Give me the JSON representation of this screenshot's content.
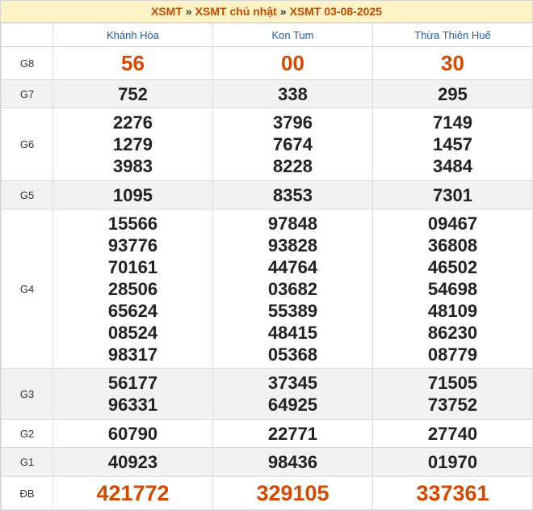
{
  "breadcrumb": {
    "items": [
      "XSMT",
      "XSMT chủ nhật",
      "XSMT 03-08-2025"
    ],
    "separator": "»"
  },
  "provinces": [
    "Khánh Hòa",
    "Kon Tum",
    "Thừa Thiên Huế"
  ],
  "colors": {
    "accent": "#d04a02",
    "link": "#1d5ea8",
    "header_bg": "#fdf3c6",
    "row_alt": "#f2f2f2"
  },
  "prizes": {
    "g8": {
      "label": "G8",
      "values": [
        [
          "56"
        ],
        [
          "00"
        ],
        [
          "30"
        ]
      ]
    },
    "g7": {
      "label": "G7",
      "values": [
        [
          "752"
        ],
        [
          "338"
        ],
        [
          "295"
        ]
      ]
    },
    "g6": {
      "label": "G6",
      "values": [
        [
          "2276",
          "1279",
          "3983"
        ],
        [
          "3796",
          "7674",
          "8228"
        ],
        [
          "7149",
          "1457",
          "3484"
        ]
      ]
    },
    "g5": {
      "label": "G5",
      "values": [
        [
          "1095"
        ],
        [
          "8353"
        ],
        [
          "7301"
        ]
      ]
    },
    "g4": {
      "label": "G4",
      "values": [
        [
          "15566",
          "93776",
          "70161",
          "28506",
          "65624",
          "08524",
          "98317"
        ],
        [
          "97848",
          "93828",
          "44764",
          "03682",
          "55389",
          "48415",
          "05368"
        ],
        [
          "09467",
          "36808",
          "46502",
          "54698",
          "48109",
          "86230",
          "08779"
        ]
      ]
    },
    "g3": {
      "label": "G3",
      "values": [
        [
          "56177",
          "96331"
        ],
        [
          "37345",
          "64925"
        ],
        [
          "71505",
          "73752"
        ]
      ]
    },
    "g2": {
      "label": "G2",
      "values": [
        [
          "60790"
        ],
        [
          "22771"
        ],
        [
          "27740"
        ]
      ]
    },
    "g1": {
      "label": "G1",
      "values": [
        [
          "40923"
        ],
        [
          "98436"
        ],
        [
          "01970"
        ]
      ]
    },
    "db": {
      "label": "ĐB",
      "values": [
        [
          "421772"
        ],
        [
          "329105"
        ],
        [
          "337361"
        ]
      ]
    }
  }
}
